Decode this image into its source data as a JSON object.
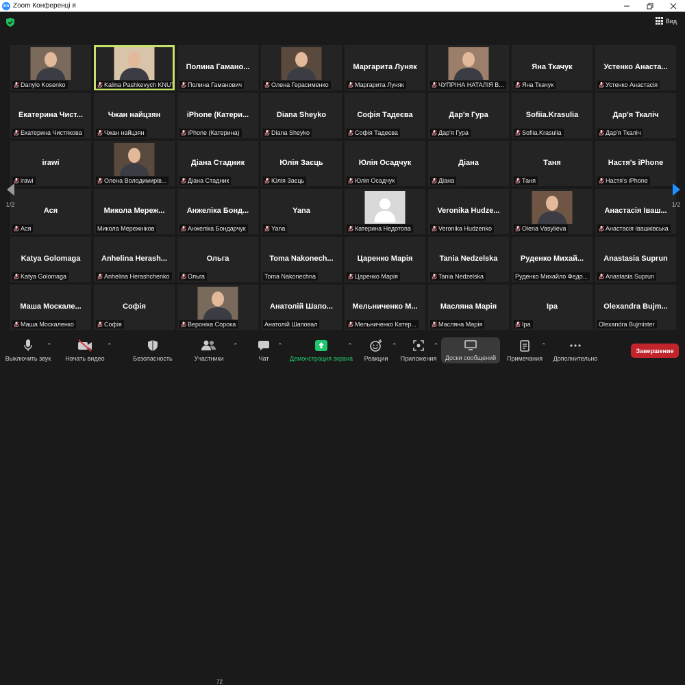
{
  "window": {
    "title": "Zoom Конференці я",
    "logo": "zm"
  },
  "topbar": {
    "view_label": "Вид"
  },
  "pager": {
    "left": "1/2",
    "right": "1/2"
  },
  "tiles": [
    {
      "big": "",
      "label": "Danylo Kosenko",
      "photo": true
    },
    {
      "big": "",
      "label": "Kalina Pashkevych KNUT...",
      "photo": true,
      "active": true
    },
    {
      "big": "Полина Гамано...",
      "label": "Полина Гаманович"
    },
    {
      "big": "",
      "label": "Олена Герасименко",
      "photo": true
    },
    {
      "big": "Маргарита Луняк",
      "label": "Маргарита Луняк"
    },
    {
      "big": "",
      "label": "ЧУПРІНА НАТАЛІЯ В...",
      "photo": true
    },
    {
      "big": "Яна Ткачук",
      "label": "Яна Ткачук"
    },
    {
      "big": "Устенко Анаста...",
      "label": "Устенко Анастасія"
    },
    {
      "big": "Екатерина Чист...",
      "label": "Екатерина Чистякова"
    },
    {
      "big": "Чжан найцзян",
      "label": "Чжан найцзян"
    },
    {
      "big": "iPhone (Катери...",
      "label": "iPhone (Катерина)"
    },
    {
      "big": "Diana Sheyko",
      "label": "Diana Sheyko"
    },
    {
      "big": "Софія Тадеєва",
      "label": "Софія Тадеєва"
    },
    {
      "big": "Дар'я Гура",
      "label": "Дар'я Гура"
    },
    {
      "big": "Sofiia.Krasulia",
      "label": "Sofiia.Krasulia"
    },
    {
      "big": "Дар'я Ткаліч",
      "label": "Дар'я Ткаліч"
    },
    {
      "big": "irawi",
      "label": "irawi"
    },
    {
      "big": "",
      "label": "Олена Володимирів...",
      "photo": true
    },
    {
      "big": "Діана Стадник",
      "label": "Діана Стадник"
    },
    {
      "big": "Юлія Заєць",
      "label": "Юлія Заєць"
    },
    {
      "big": "Юлія Осадчук",
      "label": "Юлія Осадчук"
    },
    {
      "big": "Діана",
      "label": "Діана"
    },
    {
      "big": "Таня",
      "label": "Таня"
    },
    {
      "big": "Настя's iPhone",
      "label": "Настя's iPhone"
    },
    {
      "big": "Ася",
      "label": "Ася"
    },
    {
      "big": "Микола Мереж...",
      "label": "Микола Мережніков",
      "nomic": true
    },
    {
      "big": "Анжеліка Бонд...",
      "label": "Анжеліка Бондарчук"
    },
    {
      "big": "Yana",
      "label": "Yana"
    },
    {
      "big": "",
      "label": "Катерина Недотопа",
      "photo": true,
      "avatar": true
    },
    {
      "big": "Veronika Hudze...",
      "label": "Veronika Hudzenko"
    },
    {
      "big": "",
      "label": "Olena Vasylieva",
      "photo": true
    },
    {
      "big": "Анастасія Іваш...",
      "label": "Анастасія Івашківська"
    },
    {
      "big": "Katya Golomaga",
      "label": "Katya Golomaga"
    },
    {
      "big": "Anhelina Herash...",
      "label": "Anhelina Herashchenko"
    },
    {
      "big": "Ольга",
      "label": "Ольга"
    },
    {
      "big": "Toma Nakonech...",
      "label": "Toma Nakonechna",
      "nomic": true
    },
    {
      "big": "Царенко Марія",
      "label": "Царенко Марія"
    },
    {
      "big": "Tania Nedzelska",
      "label": "Tania Nedzelska"
    },
    {
      "big": "Руденко Михай...",
      "label": "Руденко Михайло Федо...",
      "nomic": true
    },
    {
      "big": "Anastasia Suprun",
      "label": "Anastasia Suprun"
    },
    {
      "big": "Маша Москале...",
      "label": "Маша Москаленко"
    },
    {
      "big": "Софія",
      "label": "Софія"
    },
    {
      "big": "",
      "label": "Вероніка Сорока",
      "photo": true
    },
    {
      "big": "Анатолій Шапо...",
      "label": "Анатолій Шаповал",
      "nomic": true
    },
    {
      "big": "Мельниченко М...",
      "label": "Мельниченко Катер..."
    },
    {
      "big": "Масляна Марія",
      "label": "Масляна Марія"
    },
    {
      "big": "Іра",
      "label": "Іра"
    },
    {
      "big": "Olexandra Bujm...",
      "label": "Olexandra Bujmister",
      "nomic": true
    }
  ],
  "toolbar": {
    "mute": "Выключить звук",
    "video": "Начать видео",
    "security": "Безопасность",
    "participants": "Участники",
    "participants_count": "72",
    "chat": "Чат",
    "share": "Демонстрация экрана",
    "reactions": "Реакции",
    "apps": "Приложения",
    "boards": "Доски сообщений",
    "notes": "Примечания",
    "more": "Дополнительно",
    "end": "Завершение"
  },
  "colors": {
    "active_speaker": "#c7e26b",
    "share_green": "#1ec66d",
    "end_red": "#c1242b",
    "accent_blue": "#2d8cff"
  }
}
